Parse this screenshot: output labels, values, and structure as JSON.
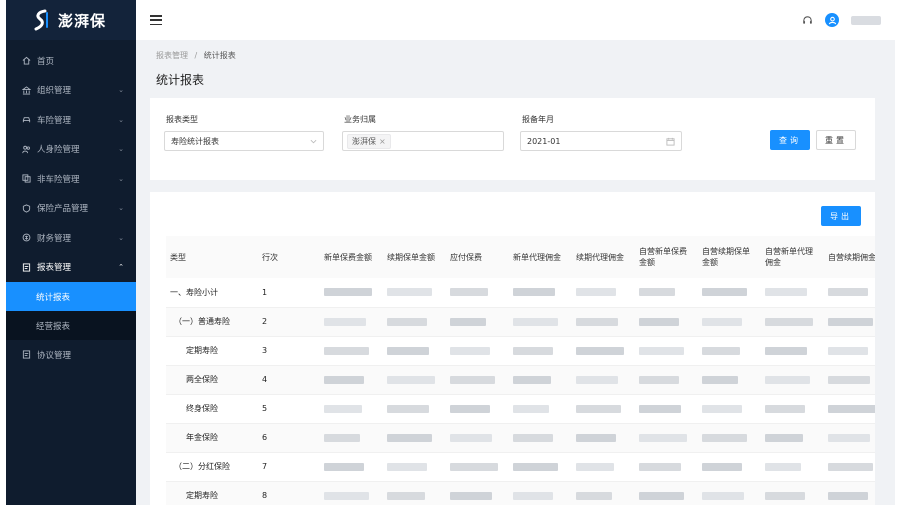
{
  "app": {
    "name": "澎湃保"
  },
  "sidebar": {
    "items": [
      {
        "label": "首页",
        "icon": "home-icon",
        "arrow": ""
      },
      {
        "label": "组织管理",
        "icon": "bank-icon",
        "arrow": "⌄"
      },
      {
        "label": "车险管理",
        "icon": "car-icon",
        "arrow": "⌄"
      },
      {
        "label": "人身险管理",
        "icon": "people-icon",
        "arrow": "⌄"
      },
      {
        "label": "非车险管理",
        "icon": "copy-icon",
        "arrow": "⌄"
      },
      {
        "label": "保险产品管理",
        "icon": "shield-icon",
        "arrow": "⌄"
      },
      {
        "label": "财务管理",
        "icon": "coin-icon",
        "arrow": "⌄"
      },
      {
        "label": "报表管理",
        "icon": "report-icon",
        "arrow": "⌃"
      }
    ],
    "sub_items": [
      {
        "label": "统计报表"
      },
      {
        "label": "经营报表"
      }
    ],
    "after": {
      "label": "协议管理",
      "icon": "agreement-icon"
    }
  },
  "breadcrumb": {
    "parent": "报表管理",
    "sep": "/",
    "current": "统计报表"
  },
  "page_title": "统计报表",
  "filters": {
    "report_type": {
      "label": "报表类型",
      "value": "寿险统计报表"
    },
    "business": {
      "label": "业务归属",
      "tag": "澎湃保",
      "tag_close": "×"
    },
    "period": {
      "label": "报备年月",
      "value": "2021-01"
    }
  },
  "buttons": {
    "search": "查询",
    "reset": "重置",
    "export": "导出"
  },
  "table": {
    "columns": [
      "类型",
      "行次",
      "新单保费金额",
      "续期保单金额",
      "应付保费",
      "新单代理佣金",
      "续期代理佣金",
      "自营新单保费金额",
      "自营续期保单金额",
      "自营新单代理佣金",
      "自营续期佣金"
    ],
    "rows": [
      {
        "type": "一、寿险小计",
        "no": "1"
      },
      {
        "type": "（一）普通寿险",
        "no": "2"
      },
      {
        "type": "定期寿险",
        "no": "3"
      },
      {
        "type": "两全保险",
        "no": "4"
      },
      {
        "type": "终身保险",
        "no": "5"
      },
      {
        "type": "年金保险",
        "no": "6"
      },
      {
        "type": "（二）分红保险",
        "no": "7"
      },
      {
        "type": "定期寿险",
        "no": "8"
      }
    ]
  },
  "colors": {
    "accent": "#1890ff",
    "sidebar_bg": "#0f1c2e"
  }
}
